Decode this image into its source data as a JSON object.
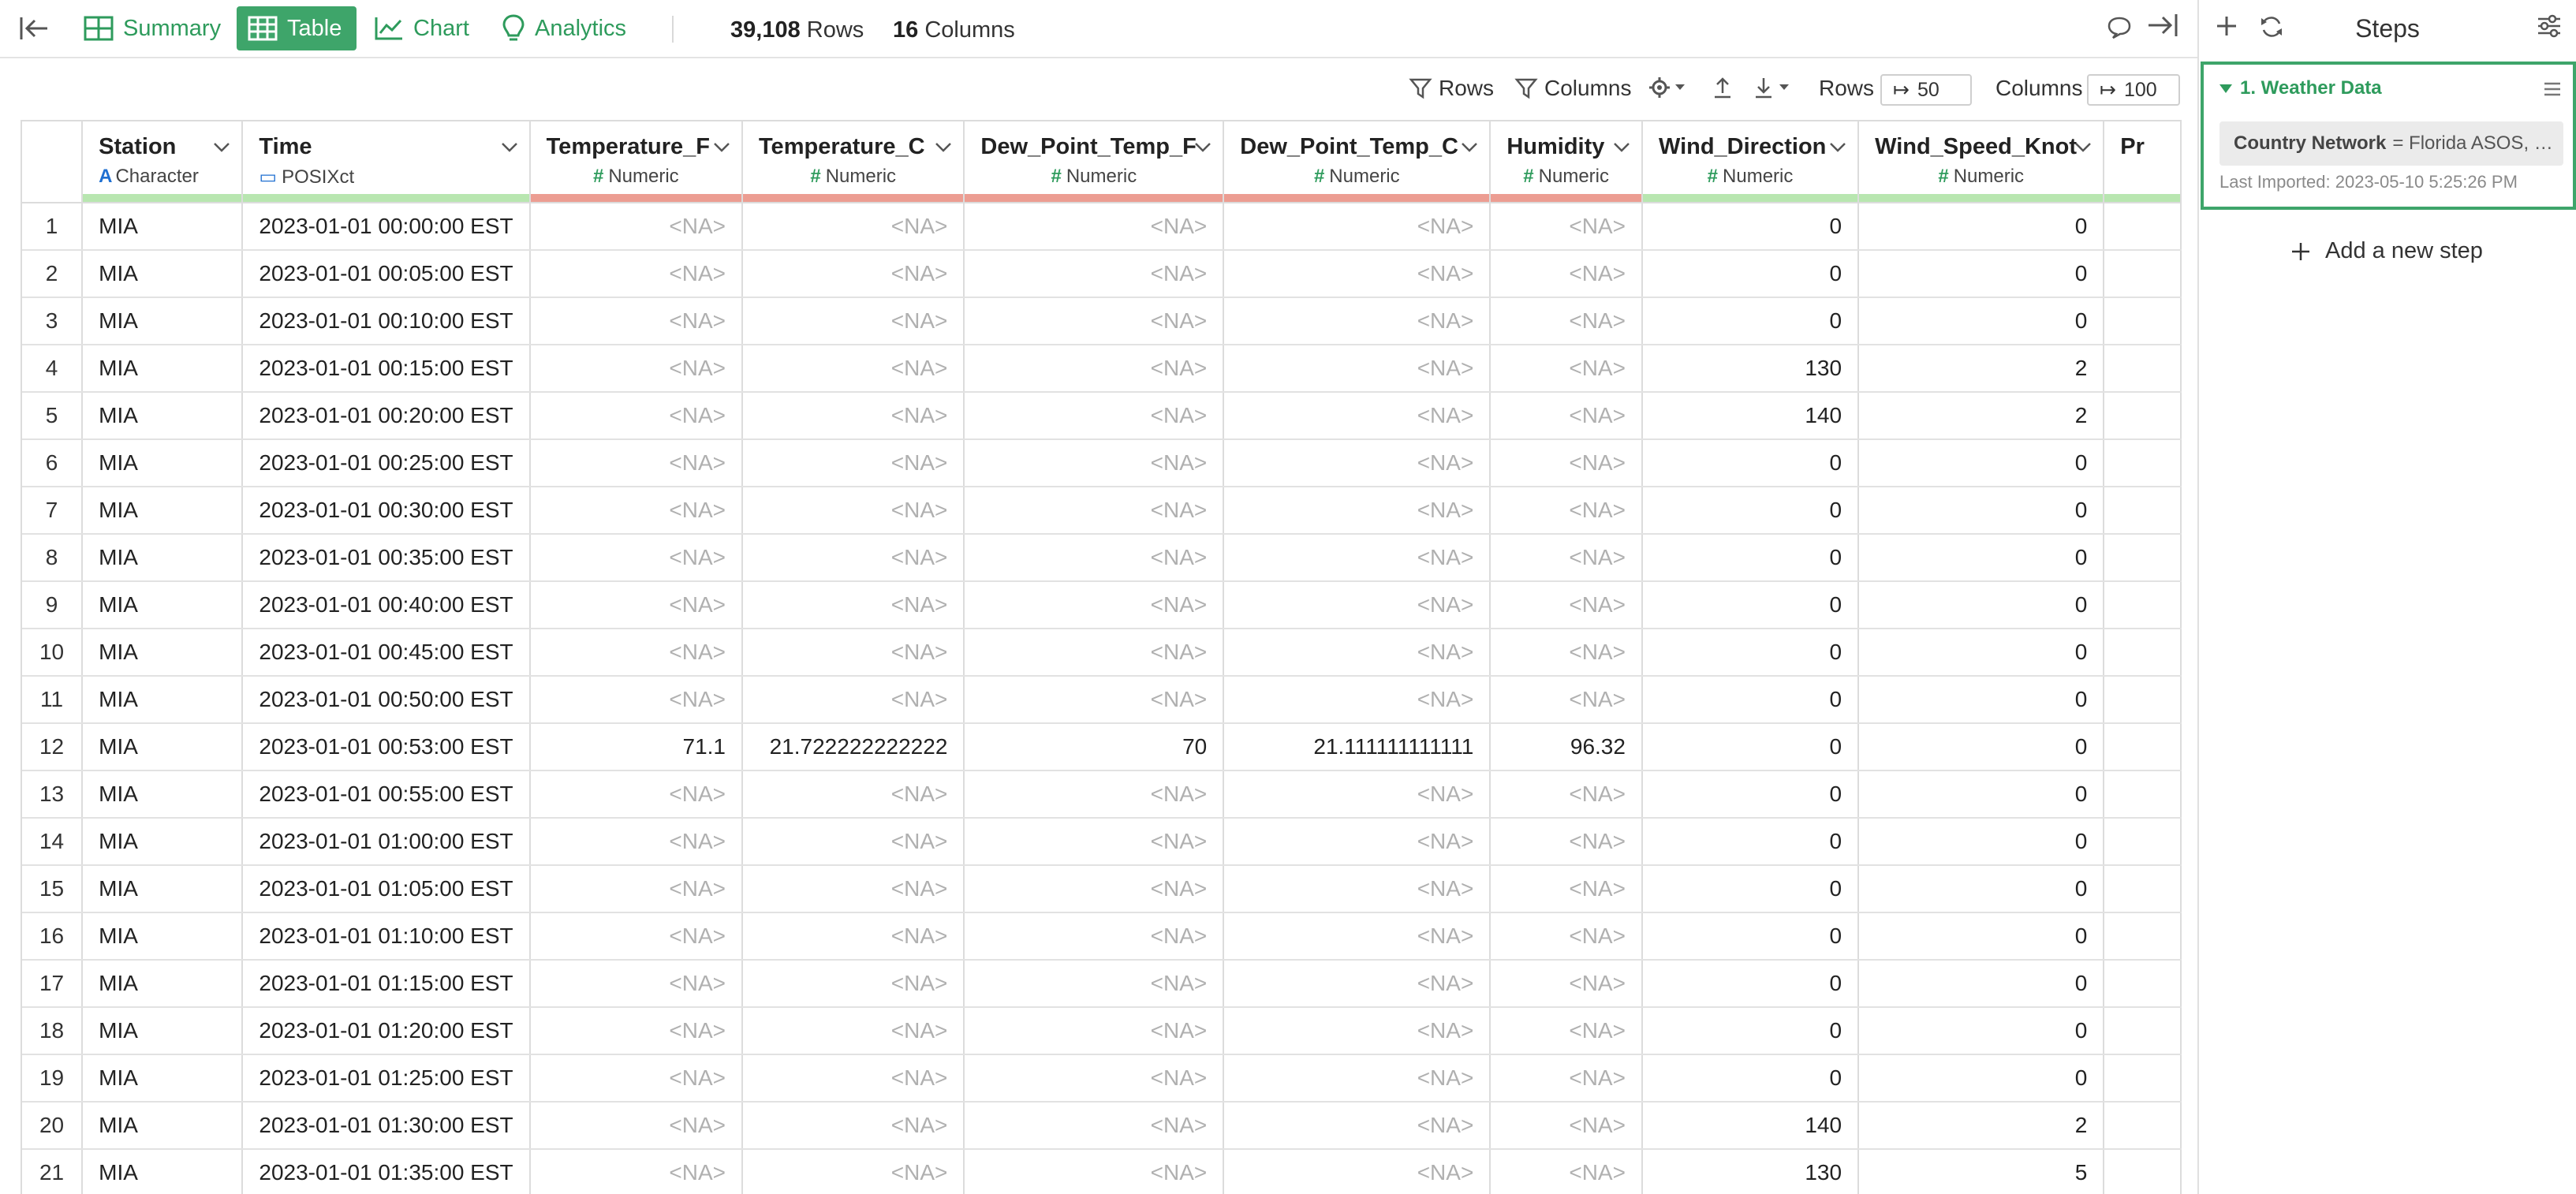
{
  "toolbar": {
    "tabs": [
      {
        "label": "Summary"
      },
      {
        "label": "Table"
      },
      {
        "label": "Chart"
      },
      {
        "label": "Analytics"
      }
    ],
    "rows_count": "39,108",
    "rows_label": "Rows",
    "cols_count": "16",
    "cols_label": "Columns"
  },
  "table_tools": {
    "rows_filter": "Rows",
    "columns_filter": "Columns",
    "rows_label": "Rows",
    "rows_value": "50",
    "columns_label": "Columns",
    "columns_value": "100"
  },
  "columns": [
    {
      "name": "Station",
      "type": "Character",
      "quality": "green",
      "align": "left"
    },
    {
      "name": "Time",
      "type": "POSIXct",
      "quality": "green",
      "align": "left"
    },
    {
      "name": "Temperature_F",
      "type": "Numeric",
      "quality": "red",
      "align": "right"
    },
    {
      "name": "Temperature_C",
      "type": "Numeric",
      "quality": "red",
      "align": "right"
    },
    {
      "name": "Dew_Point_Temp_F",
      "type": "Numeric",
      "quality": "red",
      "align": "right"
    },
    {
      "name": "Dew_Point_Temp_C",
      "type": "Numeric",
      "quality": "red",
      "align": "right"
    },
    {
      "name": "Humidity",
      "type": "Numeric",
      "quality": "red",
      "align": "right"
    },
    {
      "name": "Wind_Direction",
      "type": "Numeric",
      "quality": "green",
      "align": "right"
    },
    {
      "name": "Wind_Speed_Knot",
      "type": "Numeric",
      "quality": "green",
      "align": "right"
    },
    {
      "name": "Pr",
      "type": "",
      "quality": "green",
      "align": "right"
    }
  ],
  "rows": [
    [
      "1",
      "MIA",
      "2023-01-01 00:00:00 EST",
      "<NA>",
      "<NA>",
      "<NA>",
      "<NA>",
      "<NA>",
      "0",
      "0",
      ""
    ],
    [
      "2",
      "MIA",
      "2023-01-01 00:05:00 EST",
      "<NA>",
      "<NA>",
      "<NA>",
      "<NA>",
      "<NA>",
      "0",
      "0",
      ""
    ],
    [
      "3",
      "MIA",
      "2023-01-01 00:10:00 EST",
      "<NA>",
      "<NA>",
      "<NA>",
      "<NA>",
      "<NA>",
      "0",
      "0",
      ""
    ],
    [
      "4",
      "MIA",
      "2023-01-01 00:15:00 EST",
      "<NA>",
      "<NA>",
      "<NA>",
      "<NA>",
      "<NA>",
      "130",
      "2",
      ""
    ],
    [
      "5",
      "MIA",
      "2023-01-01 00:20:00 EST",
      "<NA>",
      "<NA>",
      "<NA>",
      "<NA>",
      "<NA>",
      "140",
      "2",
      ""
    ],
    [
      "6",
      "MIA",
      "2023-01-01 00:25:00 EST",
      "<NA>",
      "<NA>",
      "<NA>",
      "<NA>",
      "<NA>",
      "0",
      "0",
      ""
    ],
    [
      "7",
      "MIA",
      "2023-01-01 00:30:00 EST",
      "<NA>",
      "<NA>",
      "<NA>",
      "<NA>",
      "<NA>",
      "0",
      "0",
      ""
    ],
    [
      "8",
      "MIA",
      "2023-01-01 00:35:00 EST",
      "<NA>",
      "<NA>",
      "<NA>",
      "<NA>",
      "<NA>",
      "0",
      "0",
      ""
    ],
    [
      "9",
      "MIA",
      "2023-01-01 00:40:00 EST",
      "<NA>",
      "<NA>",
      "<NA>",
      "<NA>",
      "<NA>",
      "0",
      "0",
      ""
    ],
    [
      "10",
      "MIA",
      "2023-01-01 00:45:00 EST",
      "<NA>",
      "<NA>",
      "<NA>",
      "<NA>",
      "<NA>",
      "0",
      "0",
      ""
    ],
    [
      "11",
      "MIA",
      "2023-01-01 00:50:00 EST",
      "<NA>",
      "<NA>",
      "<NA>",
      "<NA>",
      "<NA>",
      "0",
      "0",
      ""
    ],
    [
      "12",
      "MIA",
      "2023-01-01 00:53:00 EST",
      "71.1",
      "21.722222222222",
      "70",
      "21.111111111111",
      "96.32",
      "0",
      "0",
      ""
    ],
    [
      "13",
      "MIA",
      "2023-01-01 00:55:00 EST",
      "<NA>",
      "<NA>",
      "<NA>",
      "<NA>",
      "<NA>",
      "0",
      "0",
      ""
    ],
    [
      "14",
      "MIA",
      "2023-01-01 01:00:00 EST",
      "<NA>",
      "<NA>",
      "<NA>",
      "<NA>",
      "<NA>",
      "0",
      "0",
      ""
    ],
    [
      "15",
      "MIA",
      "2023-01-01 01:05:00 EST",
      "<NA>",
      "<NA>",
      "<NA>",
      "<NA>",
      "<NA>",
      "0",
      "0",
      ""
    ],
    [
      "16",
      "MIA",
      "2023-01-01 01:10:00 EST",
      "<NA>",
      "<NA>",
      "<NA>",
      "<NA>",
      "<NA>",
      "0",
      "0",
      ""
    ],
    [
      "17",
      "MIA",
      "2023-01-01 01:15:00 EST",
      "<NA>",
      "<NA>",
      "<NA>",
      "<NA>",
      "<NA>",
      "0",
      "0",
      ""
    ],
    [
      "18",
      "MIA",
      "2023-01-01 01:20:00 EST",
      "<NA>",
      "<NA>",
      "<NA>",
      "<NA>",
      "<NA>",
      "0",
      "0",
      ""
    ],
    [
      "19",
      "MIA",
      "2023-01-01 01:25:00 EST",
      "<NA>",
      "<NA>",
      "<NA>",
      "<NA>",
      "<NA>",
      "0",
      "0",
      ""
    ],
    [
      "20",
      "MIA",
      "2023-01-01 01:30:00 EST",
      "<NA>",
      "<NA>",
      "<NA>",
      "<NA>",
      "<NA>",
      "140",
      "2",
      ""
    ],
    [
      "21",
      "MIA",
      "2023-01-01 01:35:00 EST",
      "<NA>",
      "<NA>",
      "<NA>",
      "<NA>",
      "<NA>",
      "130",
      "5",
      ""
    ]
  ],
  "steps": {
    "title": "Steps",
    "items": [
      {
        "name": "1. Weather Data",
        "param_key": "Country Network",
        "param_value": "= Florida ASOS, …",
        "imported": "Last Imported: 2023-05-10 5:25:26 PM"
      }
    ],
    "add_label": "Add a new step"
  },
  "colors": {
    "accent": "#3ea56a",
    "quality_ok": "#b8e6b0",
    "quality_missing": "#ec9d92",
    "na_text": "#b0b0b0"
  },
  "icons": {
    "type_character": "A",
    "type_numeric": "#"
  }
}
